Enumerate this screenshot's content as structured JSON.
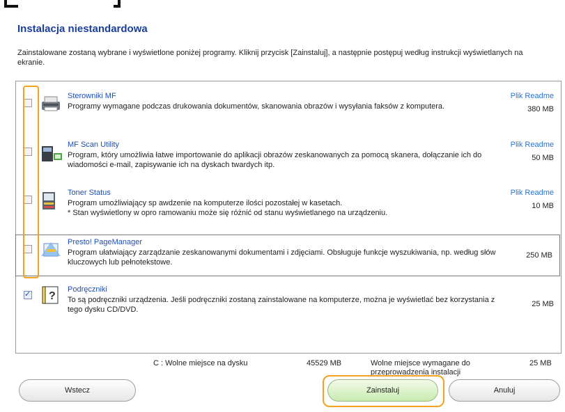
{
  "header": {
    "title": "Instalacja niestandardowa",
    "description": "Zainstalowane zostaną wybrane i wyświetlone poniżej programy. Kliknij przycisk [Zainstaluj], a następnie postępuj według instrukcji wyświetlanych na ekranie."
  },
  "items": [
    {
      "name": "Sterowniki MF",
      "desc": "Programy wymagane podczas drukowania dokumentów, skanowania obrazów i wysyłania faksów z komputera.",
      "readme": "Plik Readme",
      "size": "380 MB",
      "checked": false,
      "icon": "printer-icon"
    },
    {
      "name": "MF Scan Utility",
      "desc": "Program, który umożliwia łatwe importowanie do aplikacji obrazów zeskanowanych za pomocą skanera, dołączanie ich do wiadomości e-mail, zapisywanie ich na dyskach twardych itp.",
      "readme": "Plik Readme",
      "size": "50 MB",
      "checked": false,
      "icon": "scanner-icon"
    },
    {
      "name": "Toner Status",
      "desc": "Program umożliwiający sp    awdzenie na komputerze ilości pozostałej w kasetach.",
      "desc2": "* Stan wyświetlony w opro    ramowaniu może się różnić od stanu wyświetlanego na urządzeniu.",
      "readme": "Plik Readme",
      "size": "10 MB",
      "checked": false,
      "icon": "toner-status-icon"
    },
    {
      "name": "Presto! PageManager",
      "desc": "Program ułatwiający zarządzanie zeskanowanymi dokumentami i zdjęciami. Obsługuje funkcje wyszukiwania, np. według słów kluczowych lub pełnotekstowe.",
      "readme": "",
      "size": "250 MB",
      "checked": false,
      "icon": "page-manager-icon"
    },
    {
      "name": "Podręczniki",
      "desc": "To są podręczniki urządzenia. Jeśli podręczniki zostaną zainstalowane na komputerze, można je wyświetlać bez korzystania z tego dysku CD/DVD.",
      "readme": "",
      "size": "25 MB",
      "checked": true,
      "icon": "manual-help-icon"
    }
  ],
  "disk": {
    "drive_label": "C : Wolne miejsce na dysku",
    "free": "45529 MB",
    "required_label": "Wolne miejsce wymagane do przeprowadzenia instalacji",
    "required": "25 MB"
  },
  "buttons": {
    "back": "Wstecz",
    "install": "Zainstaluj",
    "cancel": "Anuluj"
  },
  "colors": {
    "title": "#1a3f99",
    "link": "#2c74c9",
    "highlight": "#f2a21c",
    "install_button": "#c8ebb0"
  }
}
